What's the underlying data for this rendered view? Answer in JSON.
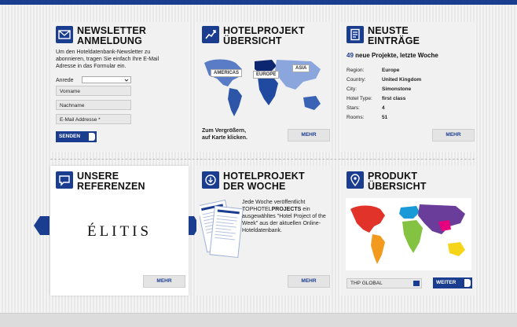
{
  "newsletter": {
    "title": "NEWSLETTER\nANMELDUNG",
    "intro": "Um den Hoteldatenbank-Newsletter zu abonnieren, tragen Sie einfach Ihre E-Mail Adresse in das Formular ein.",
    "anrede_label": "Anrede",
    "vorname_placeholder": "Vorname",
    "nachname_placeholder": "Nachname",
    "email_placeholder": "E-Mail Addresse *",
    "submit_label": "SENDEN"
  },
  "hotelprojekt_uebersicht": {
    "title": "HOTELPROJEKT\nÜBERSICHT",
    "map_labels": [
      "AMERICAS",
      "EUROPE",
      "ASIA"
    ],
    "caption": "Zum Vergrößern,\nauf Karte klicken.",
    "more_label": "MEHR"
  },
  "neueste_eintraege": {
    "title": "NEUSTE\nEINTRÄGE",
    "count": "49",
    "headline": "neue Projekte, letzte Woche",
    "rows": [
      {
        "label": "Region:",
        "value": "Europe"
      },
      {
        "label": "Country:",
        "value": "United Kingdom"
      },
      {
        "label": "City:",
        "value": "Simonstone"
      },
      {
        "label": "Hotel Type:",
        "value": "first class"
      },
      {
        "label": "Stars:",
        "value": "4"
      },
      {
        "label": "Rooms:",
        "value": "51"
      }
    ],
    "more_label": "MEHR"
  },
  "referenzen": {
    "title": "UNSERE\nREFERENZEN",
    "logo_text": "ÉLITIS",
    "more_label": "MEHR"
  },
  "hotelprojekt_woche": {
    "title": "HOTELPROJEKT\nDER WOCHE",
    "text_before": "Jede Woche veröffentlicht",
    "brand_prefix": "TOPHOTEL",
    "brand_suffix": "PROJECTS",
    "text_after": "ein ausgewähltes \"Hotel Project of the Week\" aus der aktuellen Online-Hoteldatenbank.",
    "more_label": "MEHR"
  },
  "produkt": {
    "title": "PRODUKT\nÜBERSICHT",
    "select_value": "THP GLOBAL",
    "next_label": "WEITER"
  },
  "colors": {
    "brand": "#1a3d8f",
    "panel": "#f1f1f1"
  }
}
